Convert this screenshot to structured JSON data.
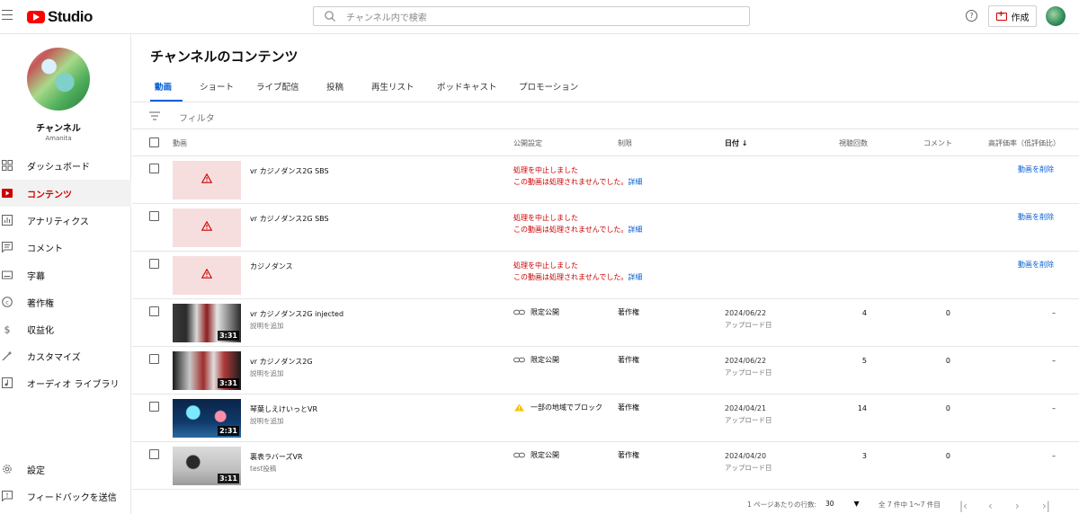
{
  "topbar": {
    "logo_text": "Studio",
    "search_placeholder": "チャンネル内で検索",
    "help_label": "?",
    "create_label": "作成"
  },
  "sidebar": {
    "channel_name": "チャンネル",
    "channel_handle": "Amanita",
    "items": [
      {
        "label": "ダッシュボード",
        "icon": "dashboard-icon"
      },
      {
        "label": "コンテンツ",
        "icon": "content-icon",
        "active": true
      },
      {
        "label": "アナリティクス",
        "icon": "analytics-icon"
      },
      {
        "label": "コメント",
        "icon": "comments-icon"
      },
      {
        "label": "字幕",
        "icon": "subtitles-icon"
      },
      {
        "label": "著作権",
        "icon": "copyright-icon"
      },
      {
        "label": "収益化",
        "icon": "monetization-icon"
      },
      {
        "label": "カスタマイズ",
        "icon": "customize-icon"
      },
      {
        "label": "オーディオ ライブラリ",
        "icon": "audio-library-icon"
      }
    ],
    "bottom_items": [
      {
        "label": "設定",
        "icon": "gear-icon"
      },
      {
        "label": "フィードバックを送信",
        "icon": "feedback-icon"
      }
    ]
  },
  "main": {
    "page_title": "チャンネルのコンテンツ",
    "tabs": [
      "動画",
      "ショート",
      "ライブ配信",
      "投稿",
      "再生リスト",
      "ポッドキャスト",
      "プロモーション"
    ],
    "filter_label": "フィルタ",
    "columns": {
      "video": "動画",
      "visibility": "公開設定",
      "restrictions": "制限",
      "date": "日付",
      "views": "視聴回数",
      "comments": "コメント",
      "ratio": "高評価率（低評価比）"
    },
    "error_rows": [
      {
        "title": "vr カジノダンス2G SBS",
        "error": "処理を中止しました",
        "error_detail": "この動画は処理されませんでした。",
        "detail_link": "詳細",
        "delete": "動画を削除"
      },
      {
        "title": "vr カジノダンス2G SBS",
        "error": "処理を中止しました",
        "error_detail": "この動画は処理されませんでした。",
        "detail_link": "詳細",
        "delete": "動画を削除"
      },
      {
        "title": "カジノダンス",
        "error": "処理を中止しました",
        "error_detail": "この動画は処理されませんでした。",
        "detail_link": "詳細",
        "delete": "動画を削除"
      }
    ],
    "rows": [
      {
        "title": "vr カジノダンス2G injected",
        "description": "説明を追加",
        "duration": "3:31",
        "visibility": "限定公開",
        "visibility_icon": "link-icon",
        "restriction": "著作権",
        "date": "2024/06/22",
        "date_label": "アップロード日",
        "views": "4",
        "comments": "0",
        "ratio": "–"
      },
      {
        "title": "vr カジノダンス2G",
        "description": "説明を追加",
        "duration": "3:31",
        "visibility": "限定公開",
        "visibility_icon": "link-icon",
        "restriction": "著作権",
        "date": "2024/06/22",
        "date_label": "アップロード日",
        "views": "5",
        "comments": "0",
        "ratio": "–"
      },
      {
        "title": "琴葉しえけいっとVR",
        "description": "説明を追加",
        "duration": "2:31",
        "visibility": "一部の地域でブロック",
        "visibility_icon": "warning-icon",
        "restriction": "著作権",
        "date": "2024/04/21",
        "date_label": "アップロード日",
        "views": "14",
        "comments": "0",
        "ratio": "–"
      },
      {
        "title": "裏表ラバーズVR",
        "description": "test投稿",
        "duration": "3:11",
        "visibility": "限定公開",
        "visibility_icon": "link-icon",
        "restriction": "著作権",
        "date": "2024/04/20",
        "date_label": "アップロード日",
        "views": "3",
        "comments": "0",
        "ratio": "–"
      }
    ],
    "footer": {
      "rows_per_page_label": "1 ページあたりの行数:",
      "rows_per_page": "30",
      "range": "全 7 件中 1〜7 件目"
    }
  },
  "colors": {
    "accent": "#065fd4",
    "brand_red": "#ff0000",
    "error_red": "#cc0000"
  }
}
